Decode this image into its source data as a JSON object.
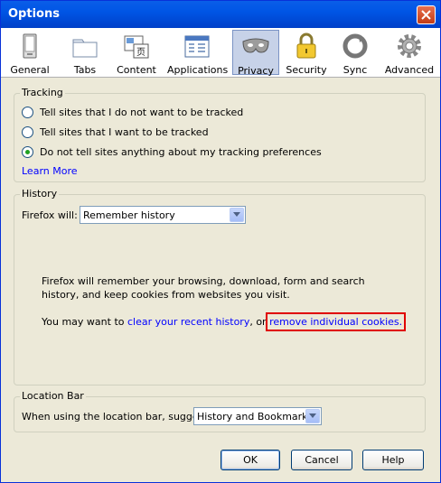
{
  "window": {
    "title": "Options"
  },
  "tabs": [
    {
      "label": "General",
      "icon": "general-icon"
    },
    {
      "label": "Tabs",
      "icon": "tabs-icon"
    },
    {
      "label": "Content",
      "icon": "content-icon"
    },
    {
      "label": "Applications",
      "icon": "applications-icon"
    },
    {
      "label": "Privacy",
      "icon": "mask-icon",
      "selected": true
    },
    {
      "label": "Security",
      "icon": "lock-icon"
    },
    {
      "label": "Sync",
      "icon": "sync-icon"
    },
    {
      "label": "Advanced",
      "icon": "gear-icon"
    }
  ],
  "tracking": {
    "legend": "Tracking",
    "options": [
      {
        "label": "Tell sites that I do not want to be tracked",
        "checked": false
      },
      {
        "label": "Tell sites that I want to be tracked",
        "checked": false
      },
      {
        "label": "Do not tell sites anything about my tracking preferences",
        "checked": true
      }
    ],
    "learn_more": "Learn More"
  },
  "history": {
    "legend": "History",
    "firefox_will_label": "Firefox will:",
    "firefox_will_value": "Remember history",
    "description": "Firefox will remember your browsing, download, form and search history, and keep cookies from websites you visit.",
    "hint_prefix": "You may want to",
    "clear_link": "clear your recent history",
    "hint_or": ", or",
    "cookies_link": "remove individual cookies."
  },
  "location_bar": {
    "legend": "Location Bar",
    "suggest_label": "When using the location bar, suggest:",
    "suggest_value": "History and Bookmarks"
  },
  "buttons": {
    "ok": "OK",
    "cancel": "Cancel",
    "help": "Help"
  },
  "colors": {
    "titlebar": "#0055e5",
    "dialog_bg": "#ece9d8",
    "link": "#0000ff",
    "highlight_box": "#e00000",
    "checked_radio": "#21a121"
  }
}
